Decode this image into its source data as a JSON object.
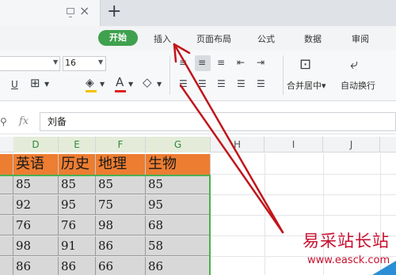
{
  "titlebar": {
    "new_tab": "+",
    "close": "×"
  },
  "menu": {
    "start": "开始",
    "insert": "插入",
    "page_layout": "页面布局",
    "formulas": "公式",
    "data": "数据",
    "review": "审阅"
  },
  "toolbar": {
    "font_size": "16",
    "merge_center": "合并居中▾",
    "auto_wrap": "自动换行",
    "font_color_accent": "#e02020",
    "fill_color_accent": "#f2c200"
  },
  "formula_bar": {
    "fx": "fx",
    "value": "刘备"
  },
  "columns": [
    "D",
    "E",
    "F",
    "G",
    "H",
    "I",
    "J"
  ],
  "table": {
    "headers": [
      "英语",
      "历史",
      "地理",
      "生物"
    ],
    "rows": [
      [
        "85",
        "85",
        "85",
        "85"
      ],
      [
        "92",
        "95",
        "75",
        "95"
      ],
      [
        "76",
        "76",
        "98",
        "68"
      ],
      [
        "98",
        "91",
        "86",
        "58"
      ],
      [
        "86",
        "86",
        "66",
        "86"
      ]
    ]
  },
  "watermark": {
    "title": "易采站长站",
    "url": "www.easck.com"
  },
  "colors": {
    "accent_green": "#3fa14e",
    "header_orange": "#ed7d31",
    "arrow_red": "#c0161b"
  }
}
